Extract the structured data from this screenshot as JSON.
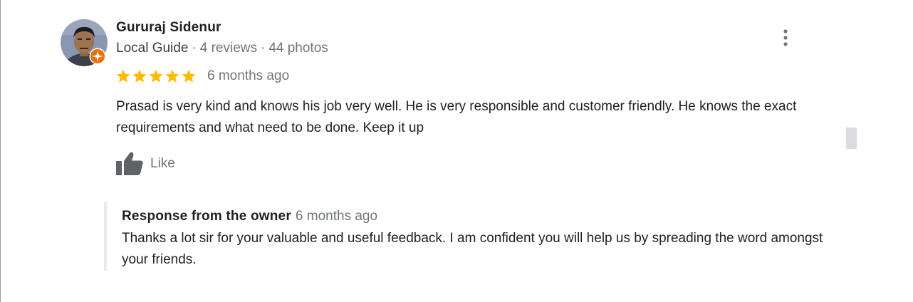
{
  "reviewer": {
    "name": "Gururaj Sidenur",
    "level": "Local Guide",
    "separator": "·",
    "reviews": "4 reviews",
    "photos": "44 photos",
    "avatar_icon": "user-photo",
    "badge_icon": "local-guide-badge-icon",
    "badge_color": "#e8710a"
  },
  "rating": {
    "stars": 5,
    "max": 5,
    "star_color": "#fbbc04",
    "date": "6 months ago"
  },
  "review": {
    "text": "Prasad is very kind and knows his job very well. He is very responsible and customer friendly. He knows the exact requirements and what need to be done. Keep it up"
  },
  "actions": {
    "like_label": "Like",
    "like_icon": "thumbs-up-icon",
    "more_icon": "more-vert-icon"
  },
  "owner_response": {
    "title": "Response from the owner",
    "date": "6 months ago",
    "text": "Thanks a lot sir for your valuable and useful feedback. I am confident you will help us by spreading the word amongst your friends."
  },
  "colors": {
    "text_primary": "#202124",
    "text_secondary": "#70757a",
    "response_border": "#e8eaed"
  }
}
